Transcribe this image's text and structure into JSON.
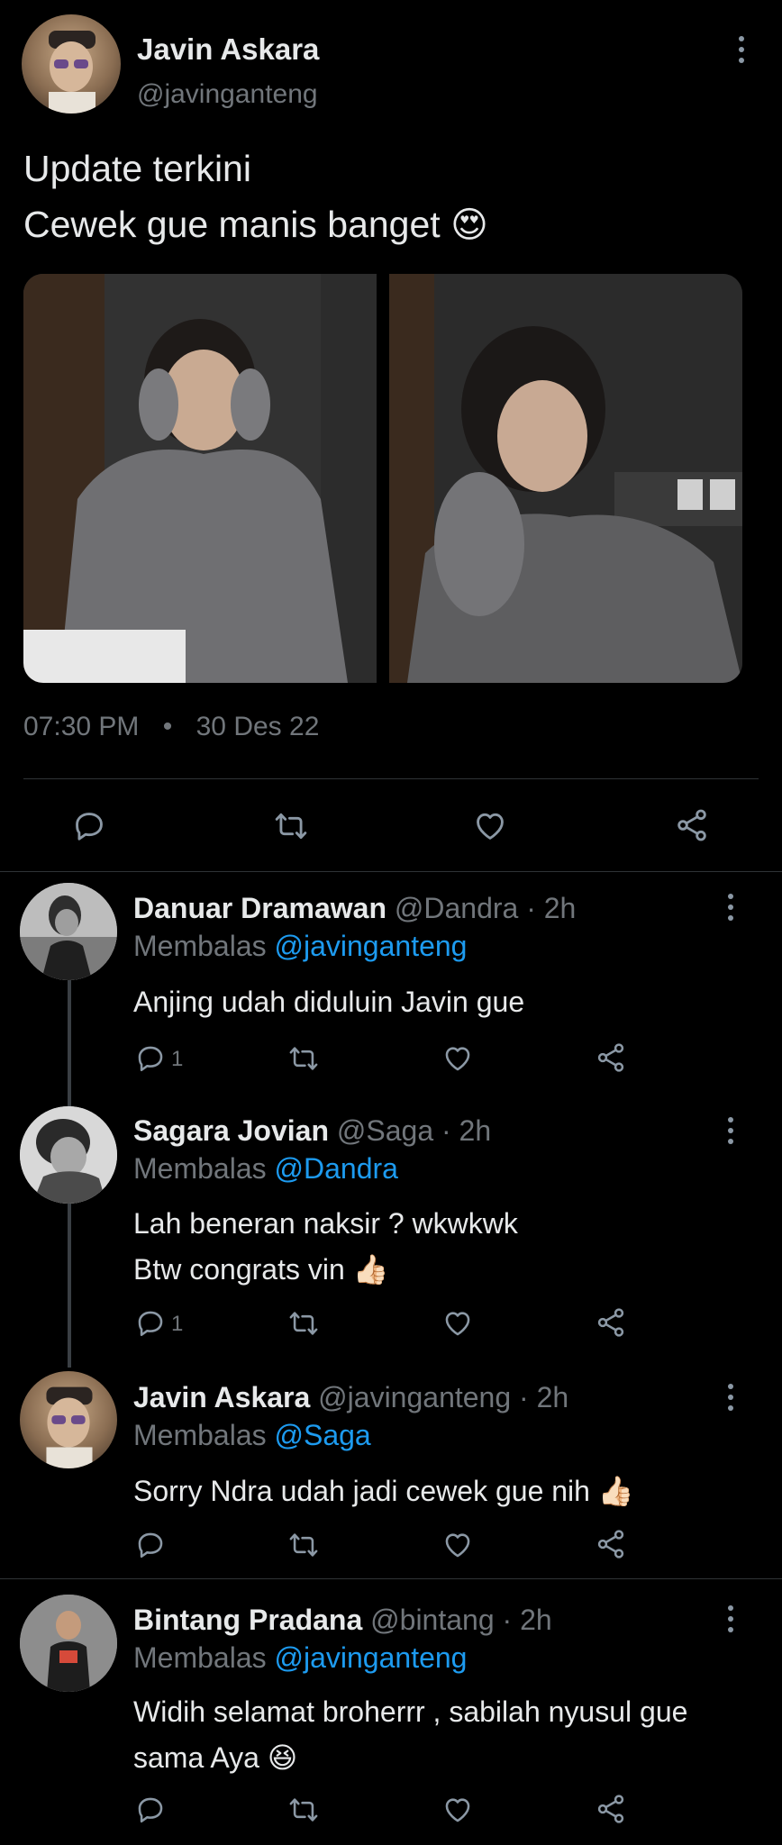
{
  "colors": {
    "background": "#000000",
    "text": "#e7e9ea",
    "muted": "#71767b",
    "link": "#1d9bf0",
    "divider": "#2f3336"
  },
  "main_tweet": {
    "name": "Javin Askara",
    "handle": "@javinganteng",
    "text_line1": "Update terkini",
    "text_line2": "Cewek gue manis banget",
    "emoji": "😍",
    "time": "07:30 PM",
    "dot": "•",
    "date": "30 Des 22",
    "photos": [
      "photo-left",
      "photo-right"
    ],
    "actions": [
      "reply-icon",
      "retweet-icon",
      "like-icon",
      "share-icon"
    ]
  },
  "replies": [
    {
      "name": "Danuar Dramawan",
      "handle": "@Dandra",
      "sep": "·",
      "time": "2h",
      "replying_prefix": "Membalas",
      "replying_to": "@javinganteng",
      "text_line1": "Anjing udah diduluin Javin gue",
      "text_line2": "",
      "reply_count": "1"
    },
    {
      "name": "Sagara Jovian",
      "handle": "@Saga",
      "sep": "·",
      "time": "2h",
      "replying_prefix": "Membalas",
      "replying_to": "@Dandra",
      "text_line1": "Lah beneran naksir ? wkwkwk",
      "text_line2": "Btw congrats vin",
      "emoji": "👍🏻",
      "reply_count": "1"
    },
    {
      "name": "Javin Askara",
      "handle": "@javinganteng",
      "sep": "·",
      "time": "2h",
      "replying_prefix": "Membalas",
      "replying_to": "@Saga",
      "text_line1": "Sorry Ndra udah jadi cewek gue nih",
      "emoji": "👍🏻",
      "reply_count": ""
    },
    {
      "name": "Bintang Pradana",
      "handle": "@bintang",
      "sep": "·",
      "time": "2h",
      "replying_prefix": "Membalas",
      "replying_to": "@javinganteng",
      "text_line1": "Widih selamat broherrr , sabilah nyusul gue",
      "text_line2": "sama Aya",
      "emoji": "😆",
      "reply_count": ""
    }
  ]
}
